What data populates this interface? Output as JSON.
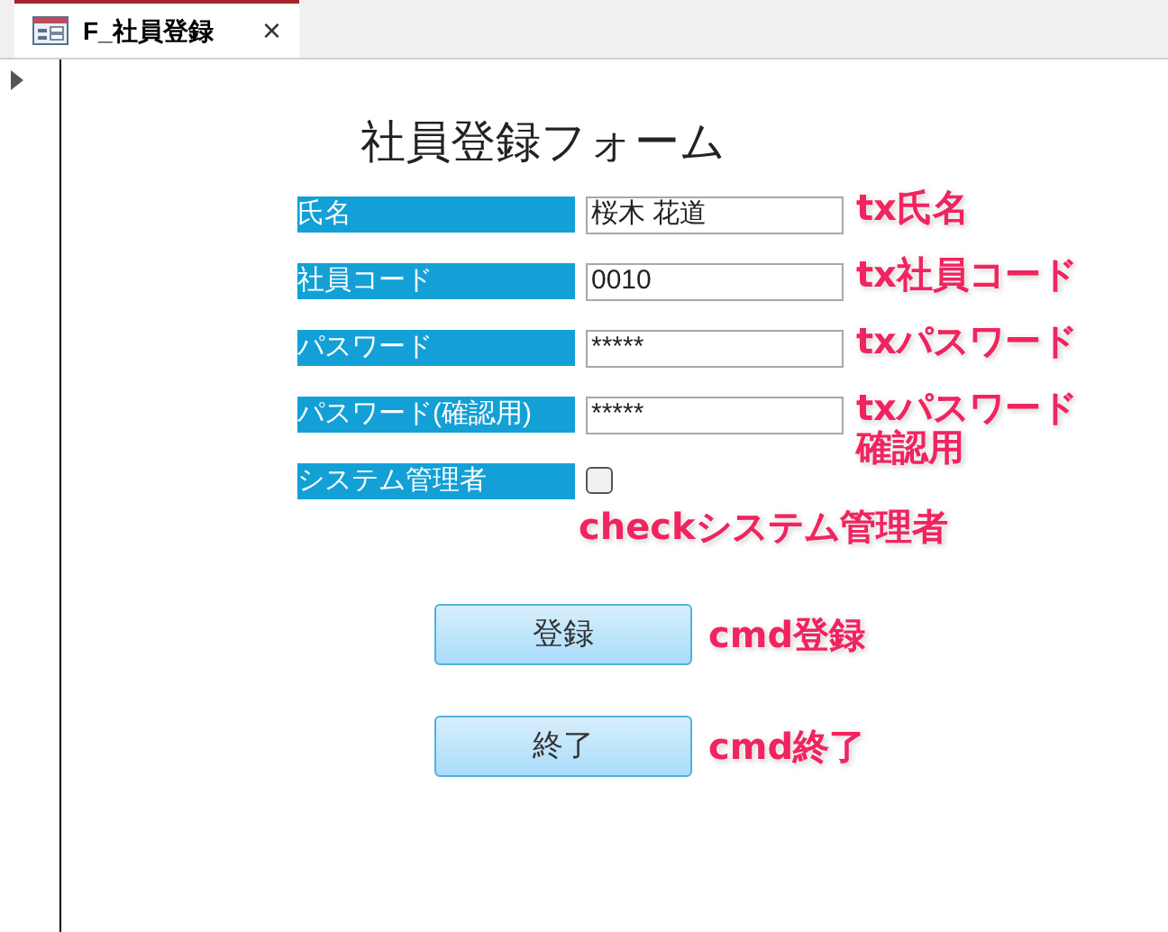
{
  "tab": {
    "title": "F_社員登録",
    "close": "×",
    "selected": true
  },
  "form": {
    "title": "社員登録フォーム",
    "fields": [
      {
        "kind": "text",
        "label": "氏名",
        "value": "桜木 花道",
        "note": "tx氏名"
      },
      {
        "kind": "text",
        "label": "社員コード",
        "value": "0010",
        "note": "tx社員コード"
      },
      {
        "kind": "text",
        "label": "パスワード",
        "value": "*****",
        "note": "txパスワード"
      },
      {
        "kind": "text",
        "label": "パスワード(確認用)",
        "value": "*****",
        "note": "txパスワード確認用"
      },
      {
        "kind": "checkbox",
        "label": "システム管理者",
        "checked": false,
        "note": "checkシステム管理者"
      }
    ],
    "buttons": [
      {
        "label": "登録",
        "note": "cmd登録"
      },
      {
        "label": "終了",
        "note": "cmd終了"
      }
    ]
  }
}
